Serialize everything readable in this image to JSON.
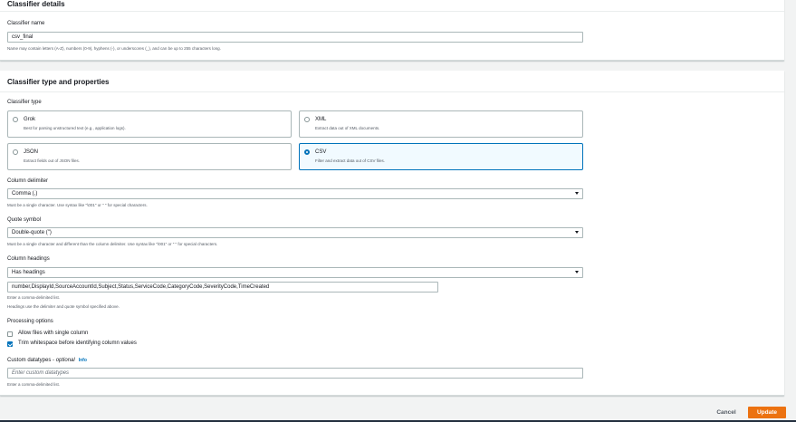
{
  "details": {
    "heading": "Classifier details",
    "name_label": "Classifier name",
    "name_value": "csv_final",
    "name_hint": "Name may contain letters (A-Z), numbers (0-9), hyphens (-), or underscores (_), and can be up to 255 characters long."
  },
  "props": {
    "heading": "Classifier type and properties",
    "type_label": "Classifier type",
    "types": [
      {
        "title": "Grok",
        "desc": "Best for parsing unstructured text (e.g., application logs).",
        "selected": false
      },
      {
        "title": "XML",
        "desc": "Extract data out of XML documents.",
        "selected": false
      },
      {
        "title": "JSON",
        "desc": "Extract fields out of JSON files.",
        "selected": false
      },
      {
        "title": "CSV",
        "desc": "Filter and extract data out of CSV files.",
        "selected": true
      }
    ],
    "delimiter_label": "Column delimiter",
    "delimiter_value": "Comma (,)",
    "delimiter_hint": "Must be a single character. Use syntax like \"\\001\" or \" \" for special characters.",
    "quote_label": "Quote symbol",
    "quote_value": "Double-quote (\")",
    "quote_hint": "Must be a single character and different than the column delimiter. Use syntax like \"\\001\" or \" \" for special characters.",
    "headings_label": "Column headings",
    "headings_value": "Has headings",
    "headings_list": "number,DisplayId,SourceAccountId,Subject,Status,ServiceCode,CategoryCode,SeverityCode,TimeCreated",
    "headings_hint1": "Enter a comma-delimited list.",
    "headings_hint2": "Headings use the delimiter and quote symbol specified above.",
    "processing_label": "Processing options",
    "allow_single_label": "Allow files with single column",
    "allow_single_checked": false,
    "trim_label": "Trim whitespace before identifying column values",
    "trim_checked": true,
    "custom_label": "Custom datatypes - ",
    "custom_optional": "optional",
    "custom_info": "Info",
    "custom_placeholder": "Enter custom datatypes",
    "custom_hint": "Enter a comma-delimited list."
  },
  "footer": {
    "cancel": "Cancel",
    "update": "Update"
  },
  "colors": {
    "accent": "#ec7211",
    "selected": "#0073bb"
  }
}
